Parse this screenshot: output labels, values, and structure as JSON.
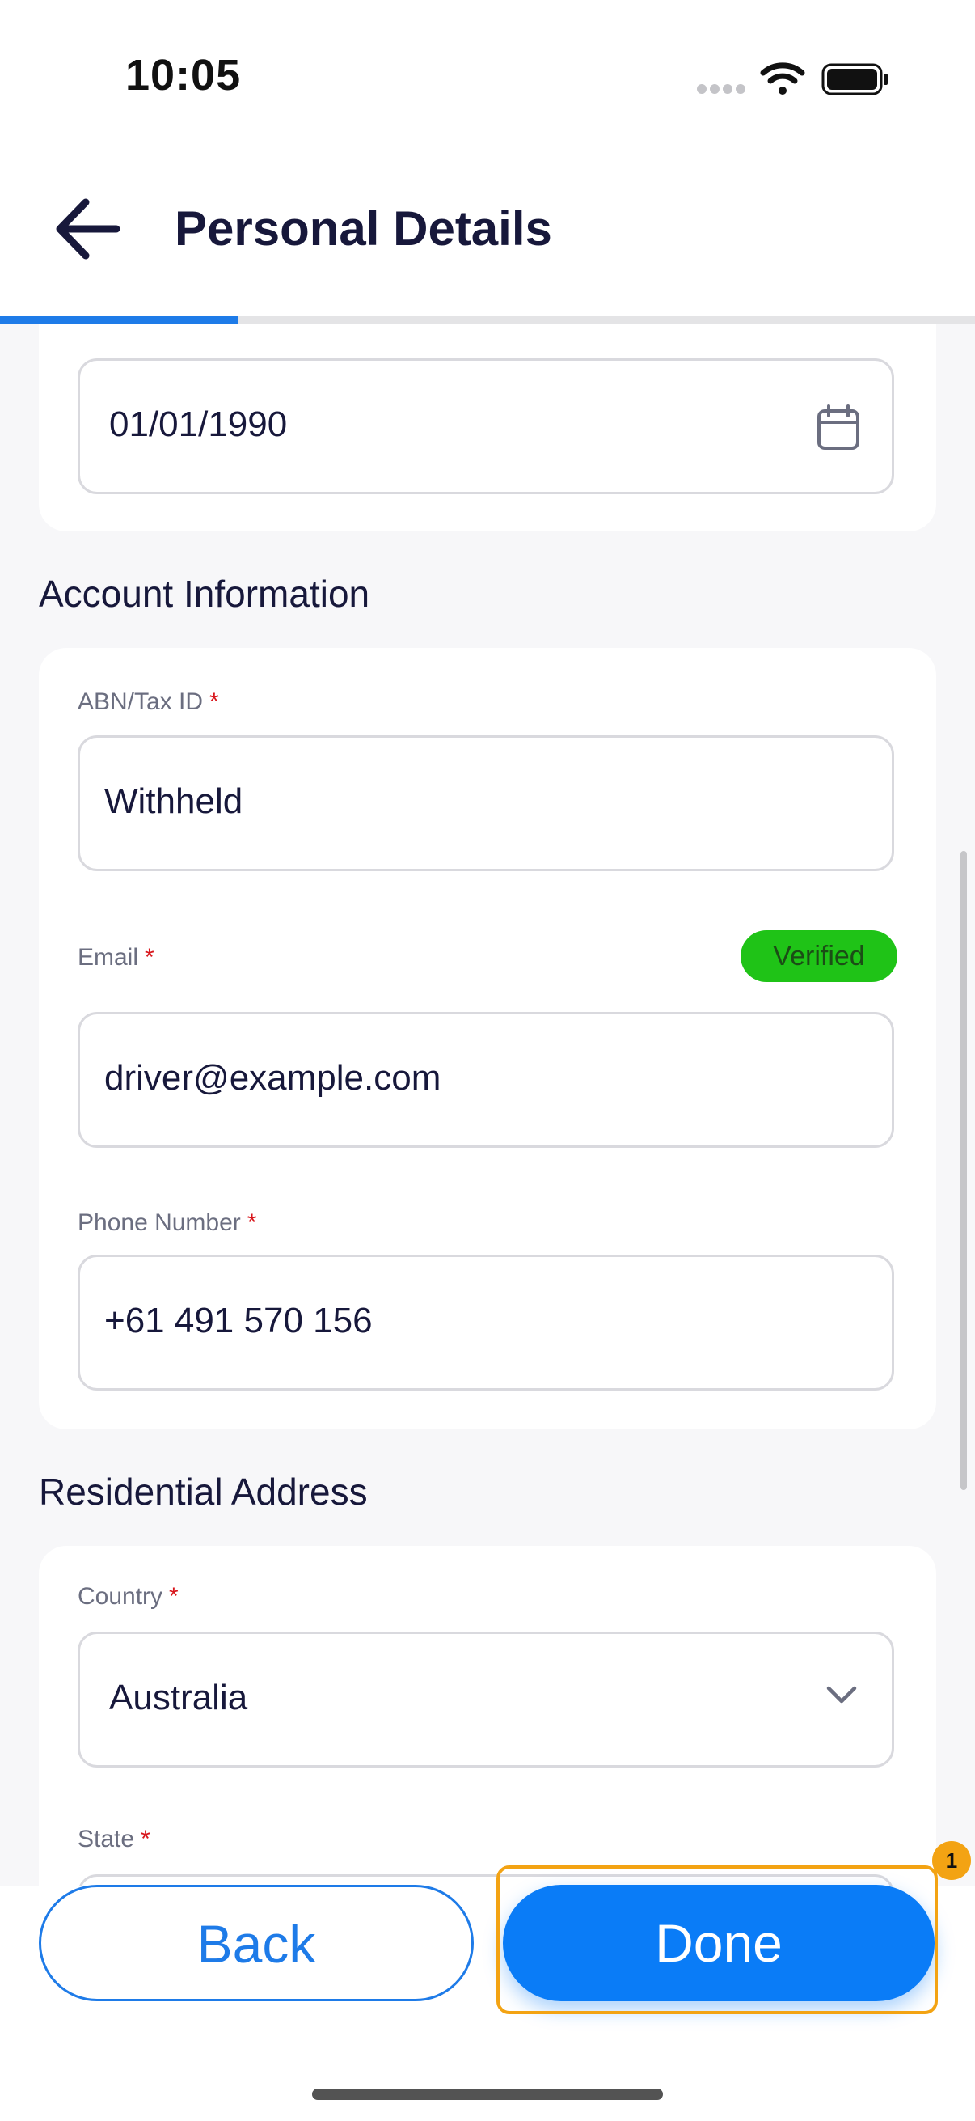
{
  "status_bar": {
    "time": "10:05"
  },
  "header": {
    "title": "Personal Details",
    "progress_fraction": 0.245
  },
  "dob_field": {
    "value": "01/01/1990"
  },
  "account_section": {
    "title": "Account Information",
    "abn": {
      "label": "ABN/Tax ID",
      "required_mark": "*",
      "value": "Withheld"
    },
    "email": {
      "label": "Email",
      "required_mark": "*",
      "value": "driver@example.com",
      "badge": "Verified"
    },
    "phone": {
      "label": "Phone Number",
      "required_mark": "*",
      "value": "+61 491 570 156"
    }
  },
  "address_section": {
    "title": "Residential Address",
    "country": {
      "label": "Country",
      "required_mark": "*",
      "value": "Australia"
    },
    "state": {
      "label": "State",
      "required_mark": "*"
    }
  },
  "actions": {
    "back_label": "Back",
    "done_label": "Done",
    "highlight_badge": "1"
  },
  "colors": {
    "accent": "#1e7be8",
    "verified": "#1fc317",
    "highlight": "#f3a313",
    "required": "#d8161c"
  }
}
